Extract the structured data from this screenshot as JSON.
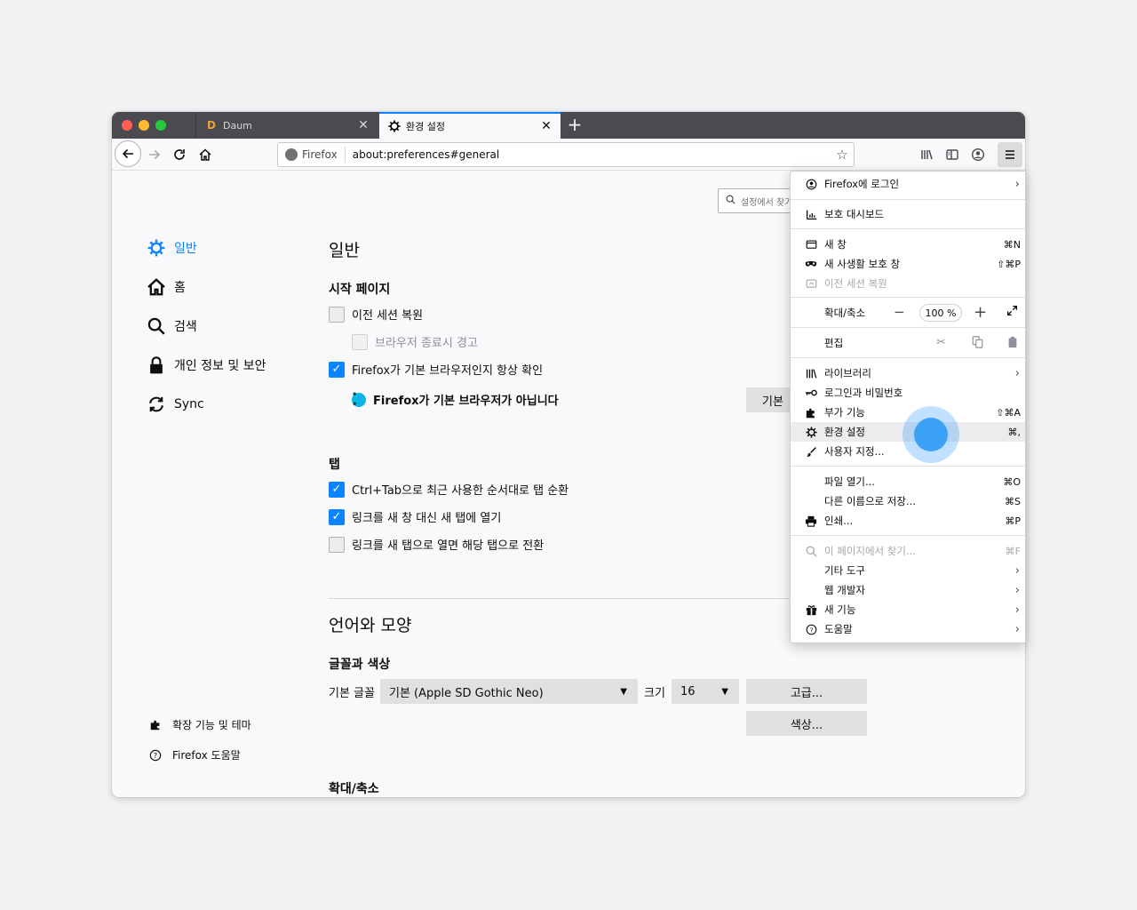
{
  "tabs": [
    {
      "title": "Daum",
      "favicon": "D"
    },
    {
      "title": "환경 설정",
      "favicon": "gear-icon"
    }
  ],
  "urlbar": {
    "identity": "Firefox",
    "url": "about:preferences#general"
  },
  "search": {
    "placeholder": "설정에서 찾기"
  },
  "sidebar": {
    "items": [
      {
        "label": "일반",
        "icon": "gear-icon",
        "selected": true
      },
      {
        "label": "홈",
        "icon": "home-icon"
      },
      {
        "label": "검색",
        "icon": "search-icon"
      },
      {
        "label": "개인 정보 및 보안",
        "icon": "lock-icon"
      },
      {
        "label": "Sync",
        "icon": "sync-icon"
      }
    ],
    "footer": [
      {
        "label": "확장 기능 및 테마",
        "icon": "puzzle-icon"
      },
      {
        "label": "Firefox 도움말",
        "icon": "help-icon"
      }
    ]
  },
  "main": {
    "title": "일반",
    "startup": {
      "heading": "시작 페이지",
      "restore_session": "이전 세션 복원",
      "warn_on_quit": "브라우저 종료시 경고",
      "check_default": "Firefox가 기본 브라우저인지 항상 확인",
      "not_default": "Firefox가 기본 브라우저가 아닙니다",
      "make_default_btn": "기본"
    },
    "tabs": {
      "heading": "탭",
      "ctrl_tab": "Ctrl+Tab으로 최근 사용한 순서대로 탭 순환",
      "open_links": "링크를 새 창 대신 새 탭에 열기",
      "switch_to_tab": "링크를 새 탭으로 열면 해당 탭으로 전환"
    },
    "language": {
      "title": "언어와 모양",
      "fonts_heading": "글꼴과 색상",
      "default_font_label": "기본 글꼴",
      "default_font_value": "기본 (Apple SD Gothic Neo)",
      "size_label": "크기",
      "size_value": "16",
      "advanced_btn": "고급...",
      "colors_btn": "색상..."
    },
    "zoom_heading": "확대/축소"
  },
  "appmenu": {
    "signin": "Firefox에 로그인",
    "protections": "보호 대시보드",
    "new_window": "새 창",
    "new_window_sc": "⌘N",
    "new_private": "새 사생활 보호 창",
    "new_private_sc": "⇧⌘P",
    "restore_session": "이전 세션 복원",
    "zoom_label": "확대/축소",
    "zoom_value": "100 %",
    "edit_label": "편집",
    "library": "라이브러리",
    "logins": "로그인과 비밀번호",
    "addons": "부가 기능",
    "addons_sc": "⇧⌘A",
    "preferences": "환경 설정",
    "preferences_sc": "⌘,",
    "customize": "사용자 지정...",
    "open_file": "파일 열기...",
    "open_file_sc": "⌘O",
    "save_as": "다른 이름으로 저장...",
    "save_as_sc": "⌘S",
    "print": "인쇄...",
    "print_sc": "⌘P",
    "find": "이 페이지에서 찾기...",
    "find_sc": "⌘F",
    "more_tools": "기타 도구",
    "web_dev": "웹 개발자",
    "whats_new": "새 기능",
    "help": "도움말"
  },
  "colors": {
    "accent": "#0a84ff",
    "tabstrip": "#4a4a4f",
    "click_indicator": "#3ba2f5"
  }
}
